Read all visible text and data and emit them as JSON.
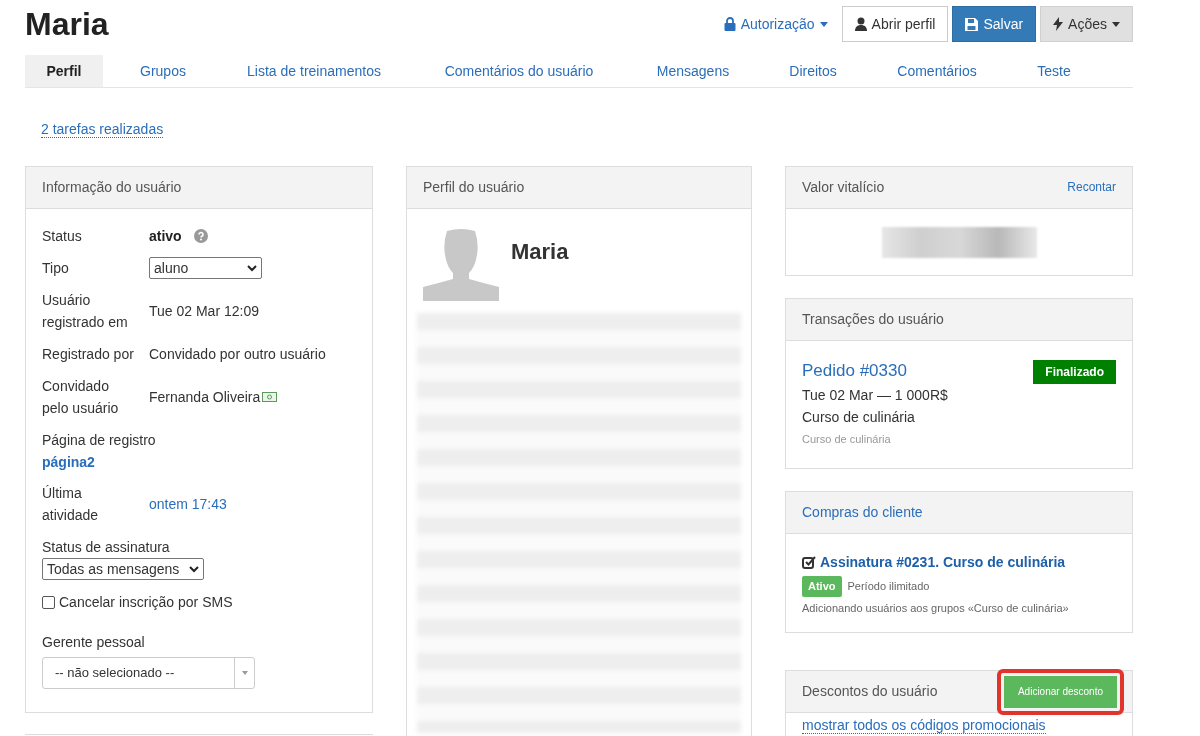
{
  "title": "Maria",
  "header_actions": [
    {
      "kind": "link",
      "label": "Autorização"
    },
    {
      "kind": "default",
      "label": "Abrir perfil"
    },
    {
      "kind": "primary",
      "label": "Salvar"
    },
    {
      "kind": "muted",
      "label": "Ações"
    }
  ],
  "tabs": [
    {
      "label": "Perfil",
      "selected": true
    },
    {
      "label": "Grupos",
      "selected": false
    },
    {
      "label": "Lista de treinamentos",
      "selected": false
    },
    {
      "label": "Comentários do usuário",
      "selected": false
    },
    {
      "label": "Mensagens",
      "selected": false
    },
    {
      "label": "Direitos",
      "selected": false
    },
    {
      "label": "Comentários",
      "selected": false
    },
    {
      "label": "Teste",
      "selected": false
    }
  ],
  "tasks_link": "2 tarefas realizadas",
  "user_info": {
    "title": "Informação do usuário",
    "rows": [
      {
        "kind": "status",
        "label": "Status",
        "value": "ativo"
      },
      {
        "kind": "select",
        "label": "Tipo",
        "value": "aluno"
      },
      {
        "kind": "text",
        "label": "Usuário registrado em",
        "value": "Tue 02 Mar 12:09"
      },
      {
        "kind": "text",
        "label": "Registrado por",
        "value": "Convidado por outro usuário"
      },
      {
        "kind": "user",
        "label": "Convidado pelo usuário",
        "value": "Fernanda Oliveira"
      },
      {
        "kind": "stacked-link",
        "label": "Página de registro",
        "value": "página2"
      },
      {
        "kind": "link",
        "label": "Última atividade",
        "value": "ontem 17:43"
      }
    ],
    "subscription": {
      "label": "Status de assinatura",
      "value": "Todas as mensagens"
    },
    "sms_opt_out": {
      "label": "Cancelar inscrição por SMS",
      "checked": false
    },
    "manager": {
      "label": "Gerente pessoal",
      "value": "-- não selecionado --"
    }
  },
  "profile": {
    "title": "Perfil do usuário",
    "name": "Maria"
  },
  "lifetime_value": {
    "title": "Valor vitalício",
    "action": "Recontar"
  },
  "transactions": {
    "title": "Transações do usuário",
    "items": [
      {
        "order": "Pedido #0330",
        "status": "Finalizado",
        "line": "Tue 02 Mar — 1 000R$",
        "product": "Curso de culinária",
        "note": "Curso de culinária"
      }
    ]
  },
  "purchases": {
    "title": "Compras do cliente",
    "items": [
      {
        "title": "Assinatura #0231. Curso de culinária",
        "status": "Ativo",
        "period": "Período ilimitado",
        "description": "Adicionando usuários aos grupos «Curso de culinária»"
      }
    ]
  },
  "discounts": {
    "title": "Descontos do usuário",
    "button": "Adicionar desconto",
    "highlighted": true,
    "link": "mostrar todos os códigos promocionais"
  }
}
